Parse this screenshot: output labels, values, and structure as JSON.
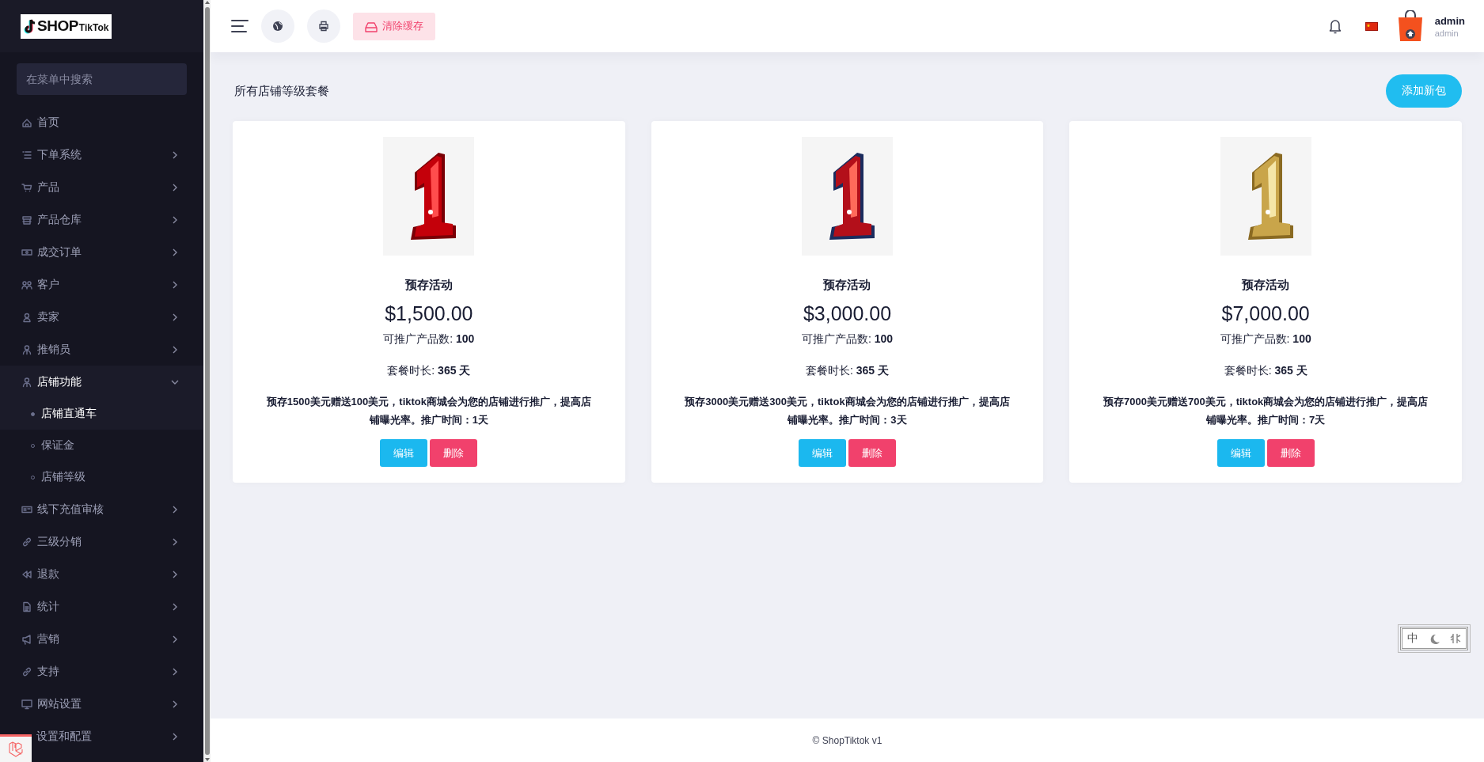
{
  "sidebar": {
    "logo": {
      "brand": "SHOP",
      "sub": "TikTok"
    },
    "search": {
      "placeholder": "在菜单中搜索"
    },
    "items": [
      {
        "label": "首页"
      },
      {
        "label": "下单系统",
        "expanded": false
      },
      {
        "label": "产品",
        "expanded": false
      },
      {
        "label": "产品仓库",
        "expanded": false
      },
      {
        "label": "成交订单",
        "expanded": false
      },
      {
        "label": "客户",
        "expanded": false
      },
      {
        "label": "卖家",
        "expanded": false
      },
      {
        "label": "推销员",
        "expanded": false
      },
      {
        "label": "店铺功能",
        "expanded": true,
        "children": [
          {
            "label": "店铺直通车",
            "selected": true
          },
          {
            "label": "保证金",
            "selected": false
          },
          {
            "label": "店铺等级",
            "selected": false
          }
        ]
      },
      {
        "label": "线下充值审核",
        "expanded": false
      },
      {
        "label": "三级分销",
        "expanded": false
      },
      {
        "label": "退款",
        "expanded": false
      },
      {
        "label": "统计",
        "expanded": false
      },
      {
        "label": "营销",
        "expanded": false
      },
      {
        "label": "支持",
        "expanded": false
      },
      {
        "label": "网站设置",
        "expanded": false
      },
      {
        "label": "设置和配置",
        "expanded": false
      }
    ]
  },
  "topbar": {
    "clear_cache": "清除缓存",
    "user": {
      "name": "admin",
      "role": "admin"
    }
  },
  "page": {
    "title": "所有店铺等级套餐",
    "add_button": "添加新包",
    "cards": [
      {
        "title": "预存活动",
        "price": "$1,500.00",
        "products": "可推广产品数: **100**",
        "duration": "套餐时长: **365 天**",
        "description": "预存1500美元赠送100美元，tiktok商城会为您的店铺进行推广，提高店铺曝光率。推广时间：1天",
        "buttons": [
          {
            "label": "编辑",
            "kind": "edit"
          },
          {
            "label": "删除",
            "kind": "delete"
          }
        ]
      },
      {
        "title": "预存活动",
        "price": "$3,000.00",
        "products": "可推广产品数: **100**",
        "duration": "套餐时长: **365 天**",
        "description": "预存3000美元赠送300美元，tiktok商城会为您的店铺进行推广，提高店铺曝光率。推广时间：3天",
        "buttons": [
          {
            "label": "编辑",
            "kind": "edit"
          },
          {
            "label": "删除",
            "kind": "delete"
          }
        ]
      },
      {
        "title": "预存活动",
        "price": "$7,000.00",
        "products": "可推广产品数: **100**",
        "duration": "套餐时长: **365 天**",
        "description": "预存7000美元赠送700美元，tiktok商城会为您的店铺进行推广，提高店铺曝光率。推广时间：7天",
        "buttons": [
          {
            "label": "编辑",
            "kind": "edit"
          },
          {
            "label": "删除",
            "kind": "delete"
          }
        ]
      }
    ]
  },
  "ime_toolbar": {
    "mode": "中"
  },
  "footer": {
    "text": "© ShopTiktok v1"
  }
}
